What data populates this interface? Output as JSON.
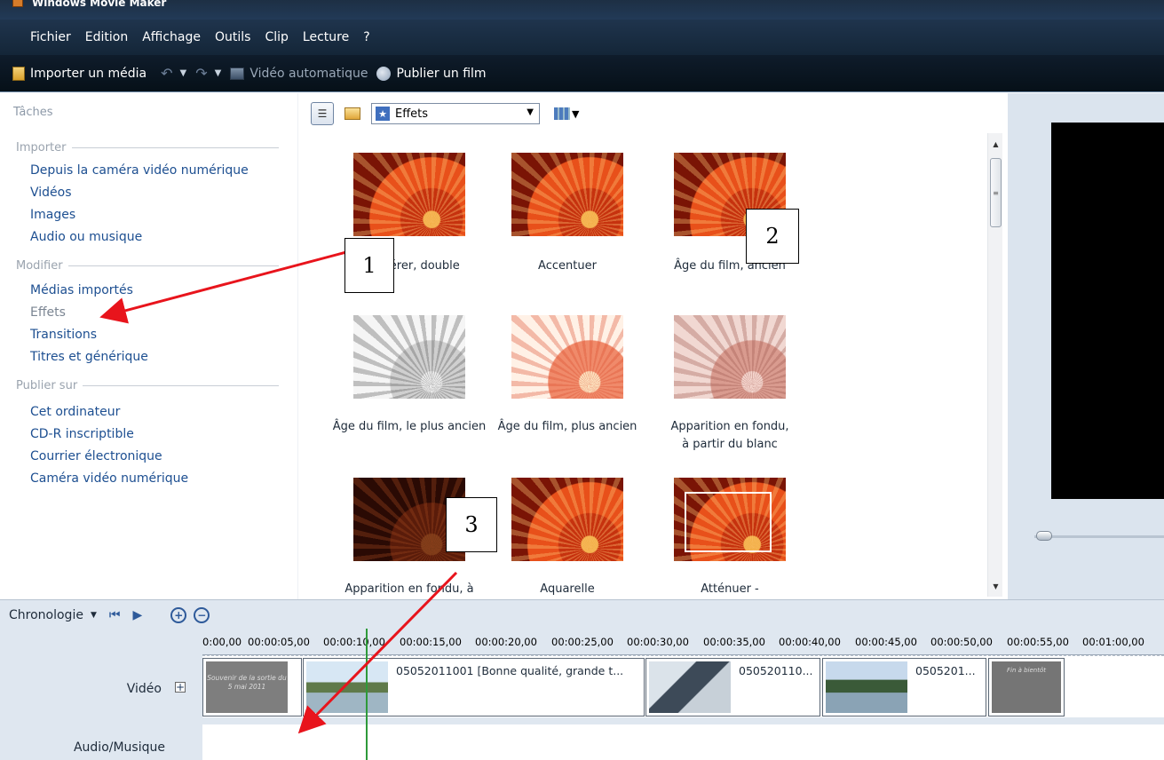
{
  "window": {
    "title": "Windows Movie Maker"
  },
  "menu": [
    "Fichier",
    "Edition",
    "Affichage",
    "Outils",
    "Clip",
    "Lecture",
    "?"
  ],
  "toolbar": {
    "import_label": "Importer un média",
    "autovideo_label": "Vidéo automatique",
    "publish_label": "Publier un film"
  },
  "tasks": {
    "title": "Tâches",
    "sections": [
      {
        "header": "Importer",
        "items": [
          "Depuis la caméra vidéo numérique",
          "Vidéos",
          "Images",
          "Audio ou musique"
        ]
      },
      {
        "header": "Modifier",
        "items": [
          "Médias importés",
          "Effets",
          "Transitions",
          "Titres et générique"
        ]
      },
      {
        "header": "Publier sur",
        "items": [
          "Cet ordinateur",
          "CD-R inscriptible",
          "Courrier électronique",
          "Caméra vidéo numérique"
        ]
      }
    ]
  },
  "content": {
    "combo_value": "Effets",
    "effects": [
      "Accélérer, double",
      "Accentuer",
      "Âge du film, ancien",
      "Âge du film, le plus ancien",
      "Âge du film, plus ancien",
      "Apparition en fondu, à partir du blanc",
      "Apparition en fondu, à",
      "Aquarelle",
      "Atténuer -"
    ]
  },
  "timeline": {
    "mode_label": "Chronologie",
    "ticks": [
      "0:00,00",
      "00:00:05,00",
      "00:00:10,00",
      "00:00:15,00",
      "00:00:20,00",
      "00:00:25,00",
      "00:00:30,00",
      "00:00:35,00",
      "00:00:40,00",
      "00:00:45,00",
      "00:00:50,00",
      "00:00:55,00",
      "00:01:00,00"
    ],
    "video_label": "Vidéo",
    "audio_label": "Audio/Musique",
    "clips": [
      {
        "caption": "",
        "thumb_text": "Souvenir de la sortie du 5 mai 2011"
      },
      {
        "caption": "05052011001 [Bonne qualité, grande t..."
      },
      {
        "caption": "050520110..."
      },
      {
        "caption": "0505201..."
      },
      {
        "caption": "",
        "thumb_text": "Fin à bientôt"
      }
    ]
  },
  "callouts": [
    "1",
    "2",
    "3"
  ],
  "colors": {
    "arrow": "#e8141c",
    "link": "#1d4f91",
    "playhead": "#2e9a3a"
  }
}
